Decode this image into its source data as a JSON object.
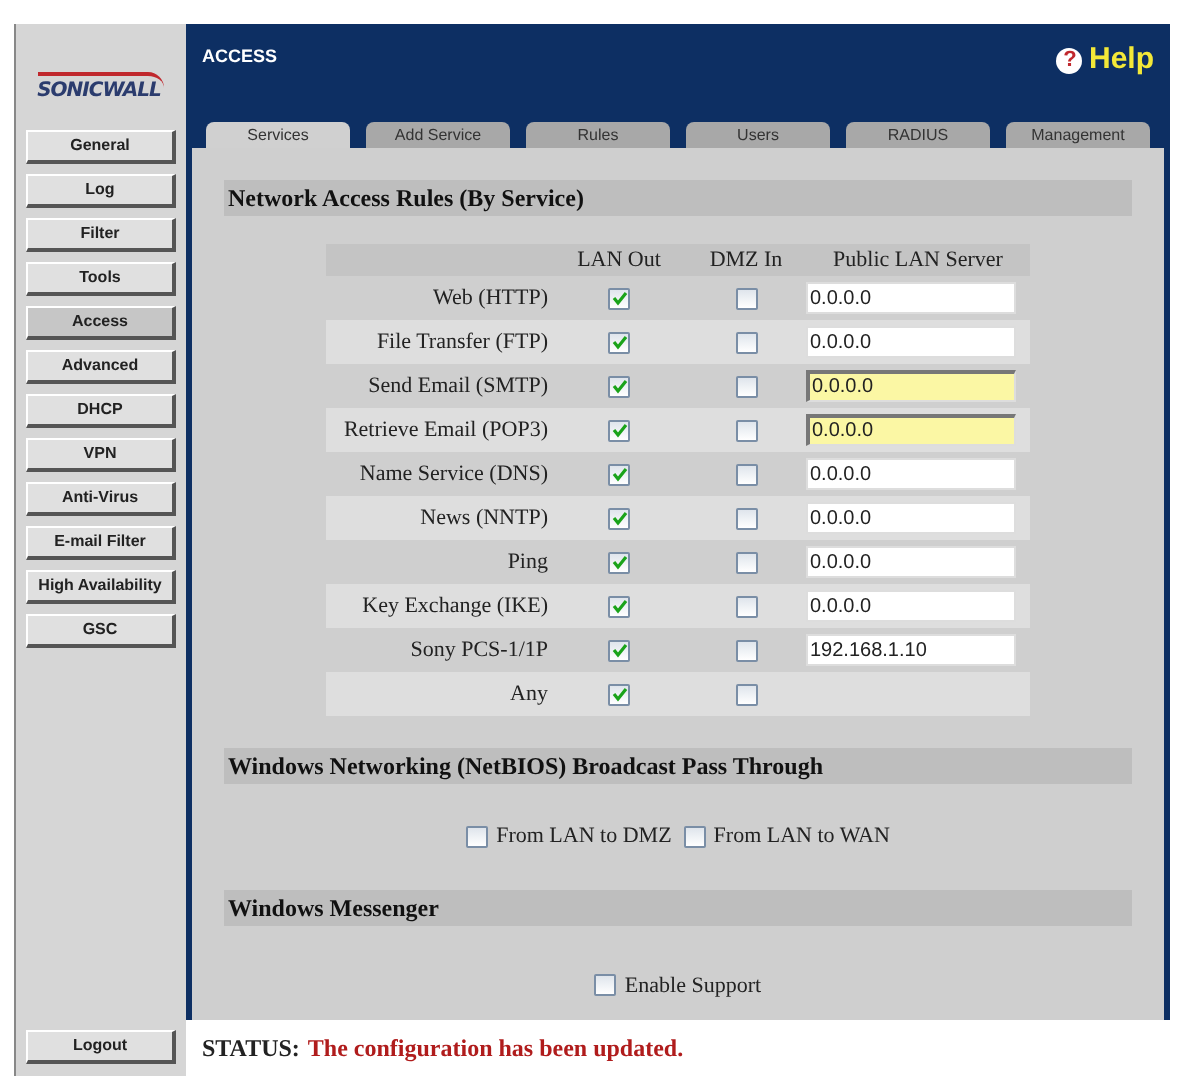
{
  "logo": {
    "text": "SONICWALL"
  },
  "sidebar": {
    "items": [
      {
        "label": "General",
        "selected": false
      },
      {
        "label": "Log",
        "selected": false
      },
      {
        "label": "Filter",
        "selected": false
      },
      {
        "label": "Tools",
        "selected": false
      },
      {
        "label": "Access",
        "selected": true
      },
      {
        "label": "Advanced",
        "selected": false
      },
      {
        "label": "DHCP",
        "selected": false
      },
      {
        "label": "VPN",
        "selected": false
      },
      {
        "label": "Anti-Virus",
        "selected": false
      },
      {
        "label": "E-mail Filter",
        "selected": false
      },
      {
        "label": "High Availability",
        "selected": false
      },
      {
        "label": "GSC",
        "selected": false
      }
    ],
    "logout": "Logout"
  },
  "header": {
    "title": "ACCESS",
    "help": "Help",
    "help_mark": "?"
  },
  "tabs": [
    {
      "label": "Services",
      "selected": true
    },
    {
      "label": "Add Service",
      "selected": false
    },
    {
      "label": "Rules",
      "selected": false
    },
    {
      "label": "Users",
      "selected": false
    },
    {
      "label": "RADIUS",
      "selected": false
    },
    {
      "label": "Management",
      "selected": false
    }
  ],
  "rules": {
    "title": "Network Access Rules (By Service)",
    "columns": [
      "LAN Out",
      "DMZ In",
      "Public LAN Server"
    ],
    "rows": [
      {
        "service": "Web (HTTP)",
        "lan_out": true,
        "dmz_in": false,
        "server": "0.0.0.0",
        "highlighted": false
      },
      {
        "service": "File Transfer (FTP)",
        "lan_out": true,
        "dmz_in": false,
        "server": "0.0.0.0",
        "highlighted": false
      },
      {
        "service": "Send Email (SMTP)",
        "lan_out": true,
        "dmz_in": false,
        "server": "0.0.0.0",
        "highlighted": true
      },
      {
        "service": "Retrieve Email (POP3)",
        "lan_out": true,
        "dmz_in": false,
        "server": "0.0.0.0",
        "highlighted": true
      },
      {
        "service": "Name Service (DNS)",
        "lan_out": true,
        "dmz_in": false,
        "server": "0.0.0.0",
        "highlighted": false
      },
      {
        "service": "News (NNTP)",
        "lan_out": true,
        "dmz_in": false,
        "server": "0.0.0.0",
        "highlighted": false
      },
      {
        "service": "Ping",
        "lan_out": true,
        "dmz_in": false,
        "server": "0.0.0.0",
        "highlighted": false
      },
      {
        "service": "Key Exchange (IKE)",
        "lan_out": true,
        "dmz_in": false,
        "server": "0.0.0.0",
        "highlighted": false
      },
      {
        "service": "Sony PCS-1/1P",
        "lan_out": true,
        "dmz_in": false,
        "server": "192.168.1.10",
        "highlighted": false
      },
      {
        "service": "Any",
        "lan_out": true,
        "dmz_in": false
      }
    ]
  },
  "netbios": {
    "title": "Windows Networking (NetBIOS) Broadcast Pass Through",
    "options": [
      {
        "label": "From LAN to DMZ",
        "checked": false
      },
      {
        "label": "From LAN to WAN",
        "checked": false
      }
    ]
  },
  "messenger": {
    "title": "Windows Messenger",
    "options": [
      {
        "label": "Enable Support",
        "checked": false
      }
    ]
  },
  "status": {
    "label": "STATUS:",
    "message": "The configuration has been updated."
  }
}
